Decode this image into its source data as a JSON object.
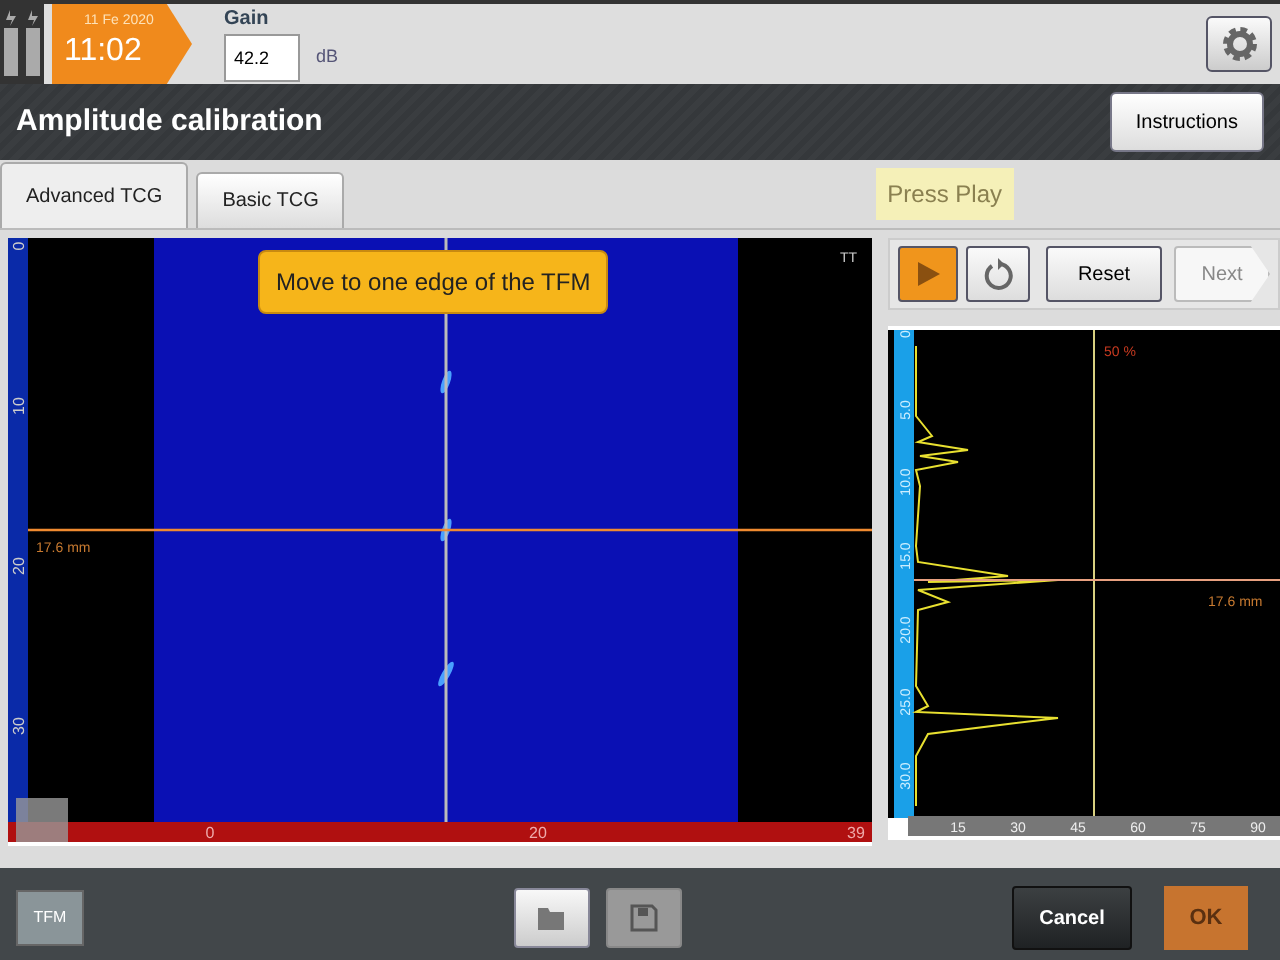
{
  "status": {
    "date": "11 Fe 2020",
    "time": "11:02"
  },
  "gain": {
    "label": "Gain",
    "value": "42.2",
    "unit": "dB"
  },
  "title": "Amplitude calibration",
  "instructions_button": "Instructions",
  "tabs": [
    {
      "label": "Advanced TCG",
      "selected": true
    },
    {
      "label": "Basic TCG",
      "selected": false
    }
  ],
  "hint": "Press Play",
  "tfm_view": {
    "callout": "Move to one edge of the TFM",
    "corner_label": "TT",
    "cursor_label": "17.6 mm",
    "y_ticks": [
      "0",
      "10",
      "20",
      "30"
    ],
    "x_ticks": [
      "0",
      "20",
      "39"
    ]
  },
  "reset_button": "Reset",
  "next_button": {
    "label": "Next",
    "disabled": true
  },
  "ascan": {
    "gate_label": "50 %",
    "cursor_label": "17.6 mm",
    "y_ticks": [
      "0",
      "5.0",
      "10.0",
      "15.0",
      "20.0",
      "25.0",
      "30.0"
    ],
    "x_ticks": [
      "15",
      "30",
      "45",
      "60",
      "75",
      "90"
    ]
  },
  "footer": {
    "mode_tile": "TFM",
    "save_disabled": true,
    "cancel_button": "Cancel",
    "ok_button": {
      "label": "OK",
      "disabled": true
    }
  }
}
